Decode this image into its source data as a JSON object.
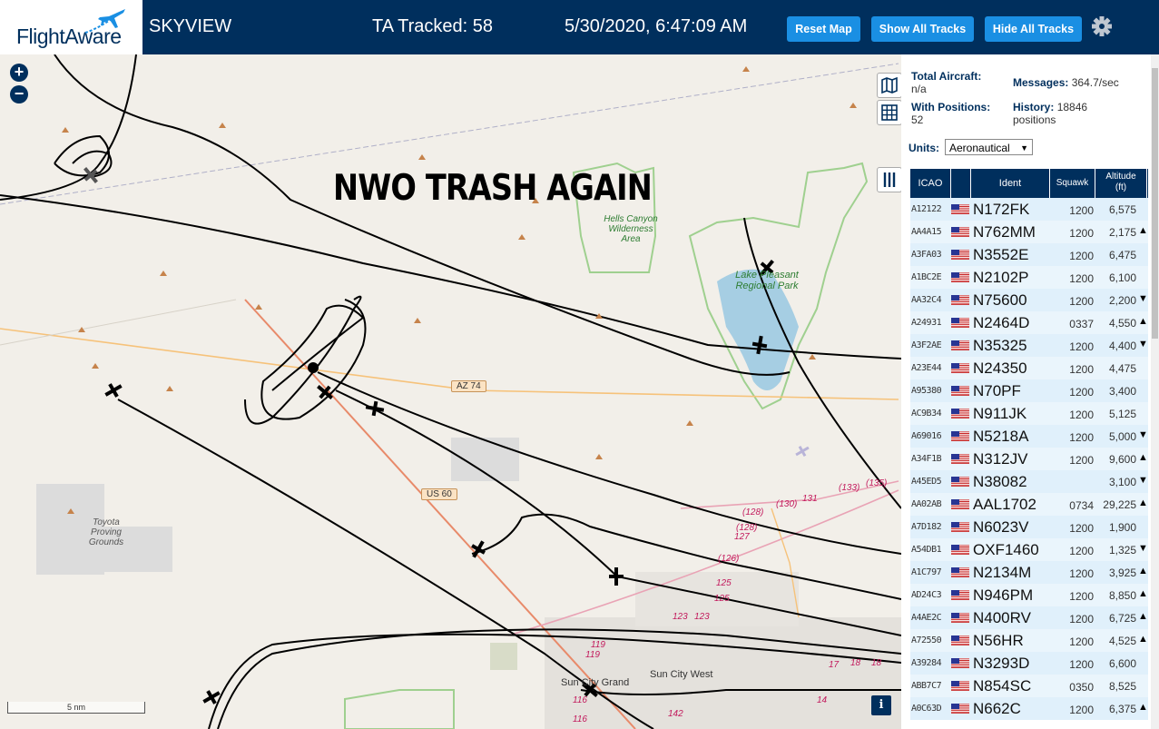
{
  "header": {
    "logo_text": "FlightAware",
    "app_name": "SKYVIEW",
    "tracked": "TA Tracked: 58",
    "datetime": "5/30/2020, 6:47:09 AM",
    "buttons": {
      "reset": "Reset Map",
      "show": "Show All Tracks",
      "hide": "Hide All Tracks"
    },
    "colors": {
      "bar": "#002f5d",
      "button": "#1a8fe3"
    }
  },
  "map": {
    "zoom_in": "+",
    "zoom_out": "−",
    "overlay_text": "NWO TRASH AGAIN",
    "labels": {
      "hells_canyon": "Hells Canyon Wilderness Area",
      "lake_pleasant": "Lake Pleasant Regional Park",
      "toyota": "Toyota Proving Grounds",
      "az74": "AZ 74",
      "us60": "US 60",
      "sun_city_grand": "Sun City Grand",
      "sun_city_west": "Sun City West"
    },
    "scale": "5 nm",
    "info": "i",
    "road_numbers": [
      "(128)",
      "(130)",
      "131",
      "(133)",
      "(135)",
      "(128)",
      "127",
      "(126)",
      "125",
      "125",
      "123",
      "123",
      "119",
      "119",
      "116",
      "116",
      "142",
      "17",
      "18",
      "18",
      "14"
    ]
  },
  "stats": {
    "total_aircraft_label": "Total Aircraft:",
    "total_aircraft_value": "n/a",
    "with_positions_label": "With Positions:",
    "with_positions_value": "52",
    "messages_label": "Messages:",
    "messages_value": "364.7/sec",
    "history_label": "History:",
    "history_value": "18846",
    "history_unit": "positions",
    "units_label": "Units:",
    "units_value": "Aeronautical"
  },
  "table": {
    "headers": {
      "icao": "ICAO",
      "ident": "Ident",
      "squawk": "Squawk",
      "altitude": "Altitude",
      "altitude_unit": "(ft)"
    },
    "rows": [
      {
        "icao": "A12122",
        "ident": "N172FK",
        "squawk": "1200",
        "alt": "6,575",
        "trend": ""
      },
      {
        "icao": "AA4A15",
        "ident": "N762MM",
        "squawk": "1200",
        "alt": "2,175",
        "trend": "▲"
      },
      {
        "icao": "A3FA03",
        "ident": "N3552E",
        "squawk": "1200",
        "alt": "6,475",
        "trend": ""
      },
      {
        "icao": "A1BC2E",
        "ident": "N2102P",
        "squawk": "1200",
        "alt": "6,100",
        "trend": ""
      },
      {
        "icao": "AA32C4",
        "ident": "N75600",
        "squawk": "1200",
        "alt": "2,200",
        "trend": "▼"
      },
      {
        "icao": "A24931",
        "ident": "N2464D",
        "squawk": "0337",
        "alt": "4,550",
        "trend": "▲"
      },
      {
        "icao": "A3F2AE",
        "ident": "N35325",
        "squawk": "1200",
        "alt": "4,400",
        "trend": "▼"
      },
      {
        "icao": "A23E44",
        "ident": "N24350",
        "squawk": "1200",
        "alt": "4,475",
        "trend": ""
      },
      {
        "icao": "A95380",
        "ident": "N70PF",
        "squawk": "1200",
        "alt": "3,400",
        "trend": ""
      },
      {
        "icao": "AC9B34",
        "ident": "N911JK",
        "squawk": "1200",
        "alt": "5,125",
        "trend": ""
      },
      {
        "icao": "A69016",
        "ident": "N5218A",
        "squawk": "1200",
        "alt": "5,000",
        "trend": "▼"
      },
      {
        "icao": "A34F1B",
        "ident": "N312JV",
        "squawk": "1200",
        "alt": "9,600",
        "trend": "▲"
      },
      {
        "icao": "A45ED5",
        "ident": "N38082",
        "squawk": "",
        "alt": "3,100",
        "trend": "▼"
      },
      {
        "icao": "AA02AB",
        "ident": "AAL1702",
        "squawk": "0734",
        "alt": "29,225",
        "trend": "▲"
      },
      {
        "icao": "A7D182",
        "ident": "N6023V",
        "squawk": "1200",
        "alt": "1,900",
        "trend": ""
      },
      {
        "icao": "A54DB1",
        "ident": "OXF1460",
        "squawk": "1200",
        "alt": "1,325",
        "trend": "▼"
      },
      {
        "icao": "A1C797",
        "ident": "N2134M",
        "squawk": "1200",
        "alt": "3,925",
        "trend": "▲"
      },
      {
        "icao": "AD24C3",
        "ident": "N946PM",
        "squawk": "1200",
        "alt": "8,850",
        "trend": "▲"
      },
      {
        "icao": "A4AE2C",
        "ident": "N400RV",
        "squawk": "1200",
        "alt": "6,725",
        "trend": "▲"
      },
      {
        "icao": "A72550",
        "ident": "N56HR",
        "squawk": "1200",
        "alt": "4,525",
        "trend": "▲"
      },
      {
        "icao": "A39284",
        "ident": "N3293D",
        "squawk": "1200",
        "alt": "6,600",
        "trend": ""
      },
      {
        "icao": "ABB7C7",
        "ident": "N854SC",
        "squawk": "0350",
        "alt": "8,525",
        "trend": ""
      },
      {
        "icao": "A0C63D",
        "ident": "N662C",
        "squawk": "1200",
        "alt": "6,375",
        "trend": "▲"
      }
    ]
  }
}
